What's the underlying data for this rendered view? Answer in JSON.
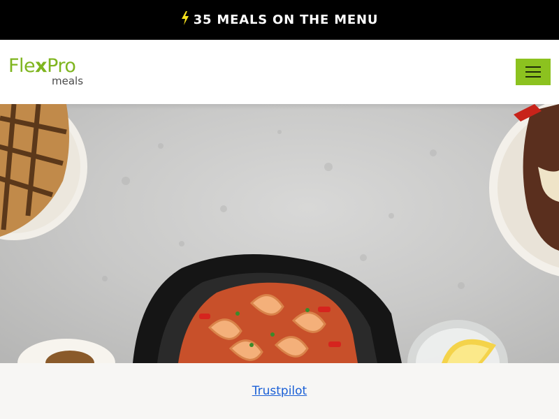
{
  "announcement": {
    "text": "35 MEALS ON THE MENU",
    "icon": "lightning-bolt-icon",
    "bolt_color": "#f7e21d"
  },
  "header": {
    "logo": {
      "brand_top_left": "Fle",
      "brand_top_x": "x",
      "brand_top_right": "Pro",
      "brand_bottom": "meals",
      "brand_color": "#7fb51f"
    },
    "menu_button": {
      "icon": "hamburger-menu-icon",
      "color": "#8cc21f"
    }
  },
  "hero": {
    "image": "food-spread-photo"
  },
  "trustpilot": {
    "link_text": "Trustpilot",
    "link_color": "#1a5fd6"
  }
}
